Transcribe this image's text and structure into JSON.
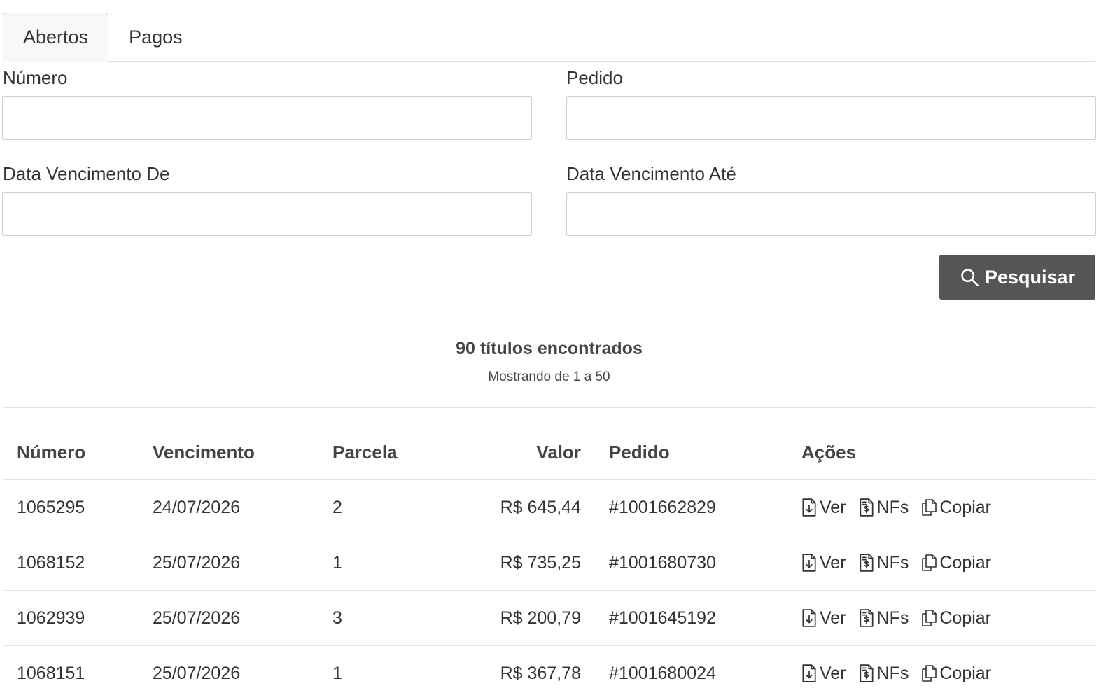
{
  "tabs": [
    {
      "label": "Abertos",
      "active": true
    },
    {
      "label": "Pagos",
      "active": false
    }
  ],
  "form": {
    "numero_label": "Número",
    "pedido_label": "Pedido",
    "data_de_label": "Data Vencimento De",
    "data_ate_label": "Data Vencimento Até",
    "numero_value": "",
    "pedido_value": "",
    "data_de_value": "",
    "data_ate_value": "",
    "search_button": "Pesquisar"
  },
  "summary": {
    "title": "90 títulos encontrados",
    "subtitle": "Mostrando de 1 a 50"
  },
  "table": {
    "headers": {
      "numero": "Número",
      "vencimento": "Vencimento",
      "parcela": "Parcela",
      "valor": "Valor",
      "pedido": "Pedido",
      "acoes": "Ações"
    },
    "action_labels": {
      "ver": "Ver",
      "nfs": "NFs",
      "copiar": "Copiar"
    },
    "rows": [
      {
        "numero": "1065295",
        "vencimento": "24/07/2026",
        "parcela": "2",
        "valor": "R$ 645,44",
        "pedido": "#1001662829"
      },
      {
        "numero": "1068152",
        "vencimento": "25/07/2026",
        "parcela": "1",
        "valor": "R$ 735,25",
        "pedido": "#1001680730"
      },
      {
        "numero": "1062939",
        "vencimento": "25/07/2026",
        "parcela": "3",
        "valor": "R$ 200,79",
        "pedido": "#1001645192"
      },
      {
        "numero": "1068151",
        "vencimento": "25/07/2026",
        "parcela": "1",
        "valor": "R$ 367,78",
        "pedido": "#1001680024"
      }
    ]
  },
  "icons": {
    "search": "search-icon",
    "ver": "file-download-icon",
    "nfs": "file-invoice-icon",
    "copiar": "copy-icon"
  }
}
